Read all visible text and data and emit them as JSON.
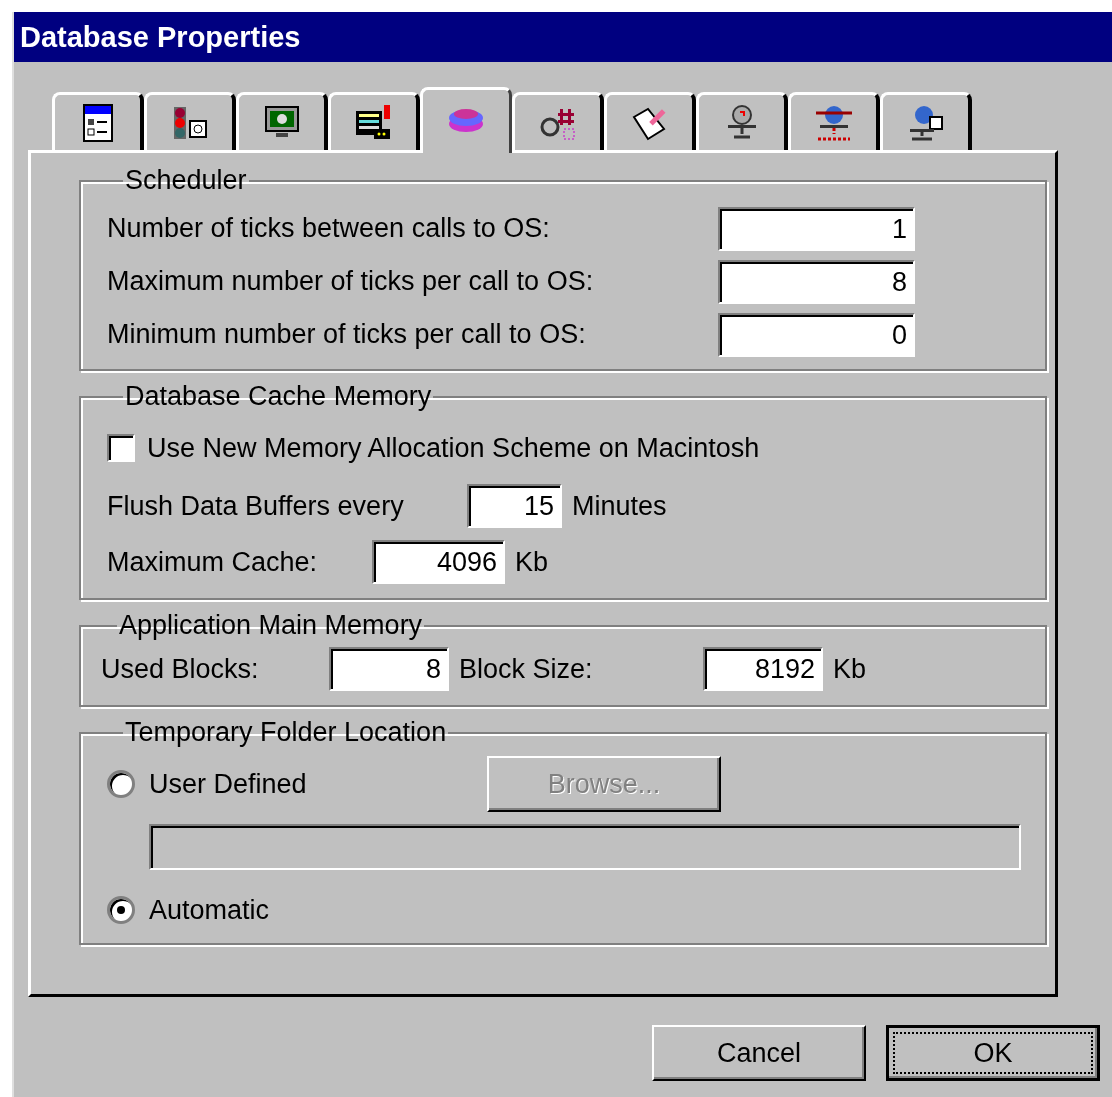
{
  "window": {
    "title": "Database Properties"
  },
  "tabs": [
    {
      "selected": false
    },
    {
      "selected": false
    },
    {
      "selected": false
    },
    {
      "selected": false
    },
    {
      "selected": true
    },
    {
      "selected": false
    },
    {
      "selected": false
    },
    {
      "selected": false
    },
    {
      "selected": false
    },
    {
      "selected": false
    }
  ],
  "scheduler": {
    "title": "Scheduler",
    "fields": [
      {
        "label": "Number of ticks between calls to OS:",
        "value": "1"
      },
      {
        "label": "Maximum number of ticks per call to OS:",
        "value": "8"
      },
      {
        "label": "Minimum number of ticks per call to OS:",
        "value": "0"
      }
    ]
  },
  "cache": {
    "title": "Database Cache Memory",
    "new_memory_scheme": {
      "label": "Use New Memory Allocation Scheme on Macintosh",
      "checked": false
    },
    "flush": {
      "label": "Flush Data Buffers every",
      "value": "15",
      "unit": "Minutes"
    },
    "max_cache": {
      "label": "Maximum Cache:",
      "value": "4096",
      "unit": "Kb"
    }
  },
  "app_memory": {
    "title": "Application Main Memory",
    "used_blocks": {
      "label": "Used Blocks:",
      "value": "8"
    },
    "block_size": {
      "label": "Block Size:",
      "value": "8192",
      "unit": "Kb"
    }
  },
  "temp_folder": {
    "title": "Temporary Folder Location",
    "options": [
      {
        "label": "User Defined",
        "selected": false
      },
      {
        "label": "Automatic",
        "selected": true
      }
    ],
    "browse": {
      "label": "Browse...",
      "disabled": true
    },
    "path": {
      "disabled": true
    }
  },
  "buttons": [
    {
      "label": "Cancel",
      "default": false
    },
    {
      "label": "OK",
      "default": true
    }
  ]
}
